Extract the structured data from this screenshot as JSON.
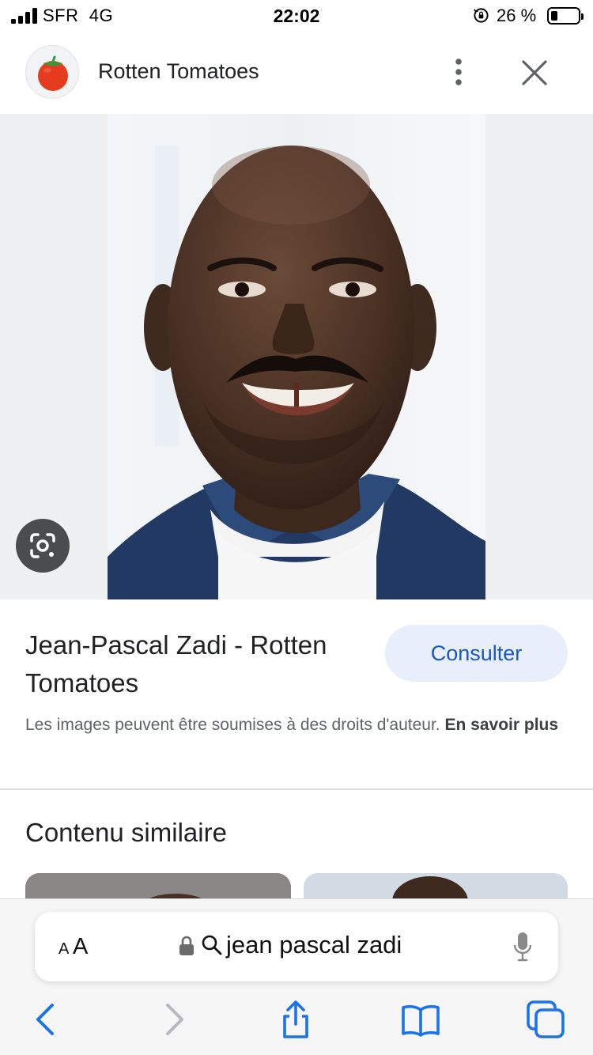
{
  "status_bar": {
    "carrier": "SFR",
    "network": "4G",
    "time": "22:02",
    "battery_percent": "26 %",
    "battery_level": 0.26
  },
  "header": {
    "site_name": "Rotten Tomatoes",
    "logo_icon": "tomato-icon",
    "more_icon": "more-vert-icon",
    "close_icon": "close-icon"
  },
  "image": {
    "lens_icon": "google-lens-icon",
    "background_color": "#eff0f2"
  },
  "result": {
    "title": "Jean-Pascal Zadi - Rotten Tomatoes",
    "consult_label": "Consulter",
    "copyright_text": "Les images peuvent être soumises à des droits d'auteur.",
    "learn_more_label": "En savoir plus"
  },
  "similar": {
    "heading": "Contenu similaire"
  },
  "browser": {
    "text_size_label_small": "A",
    "text_size_label_big": "A",
    "url_query": "jean pascal zadi",
    "nav_icons": [
      "back-icon",
      "forward-icon",
      "share-icon",
      "bookmarks-icon",
      "tabs-icon"
    ]
  },
  "colors": {
    "accent": "#1a56c4",
    "button_bg": "#e8eefa",
    "tomato_red": "#e53b1e",
    "ios_blue": "#1a73e8"
  }
}
